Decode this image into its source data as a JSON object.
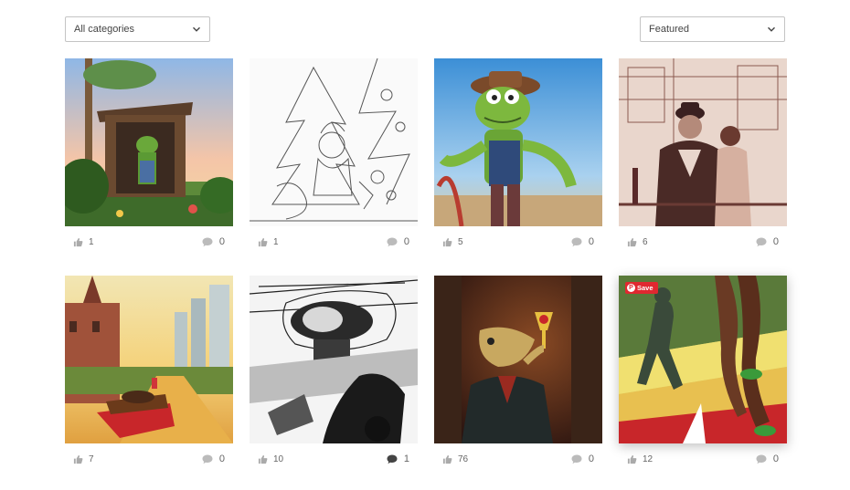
{
  "filters": {
    "category": {
      "value": "All categories"
    },
    "sort": {
      "value": "Featured"
    }
  },
  "icons": {
    "like": "thumbs-up-icon",
    "comment": "speech-bubble-icon",
    "dropdown": "chevron-down-icon",
    "pin": "pinterest-icon"
  },
  "colors": {
    "text": "#666666",
    "border": "#c4c4c4",
    "save": "#e02830"
  },
  "projects": [
    {
      "likes": "1",
      "comments": "0",
      "art": "frog-outhouse"
    },
    {
      "likes": "1",
      "comments": "0",
      "art": "pencil-sketch-tree"
    },
    {
      "likes": "5",
      "comments": "0",
      "art": "frog-cowboy"
    },
    {
      "likes": "6",
      "comments": "0",
      "art": "sepia-couple"
    },
    {
      "likes": "7",
      "comments": "0",
      "art": "canal-boat-city"
    },
    {
      "likes": "10",
      "comments": "1",
      "art": "helicopter-comic"
    },
    {
      "likes": "76",
      "comments": "0",
      "art": "fish-man-trophy"
    },
    {
      "likes": "12",
      "comments": "0",
      "art": "runners-legs",
      "save_label": "Save"
    }
  ]
}
